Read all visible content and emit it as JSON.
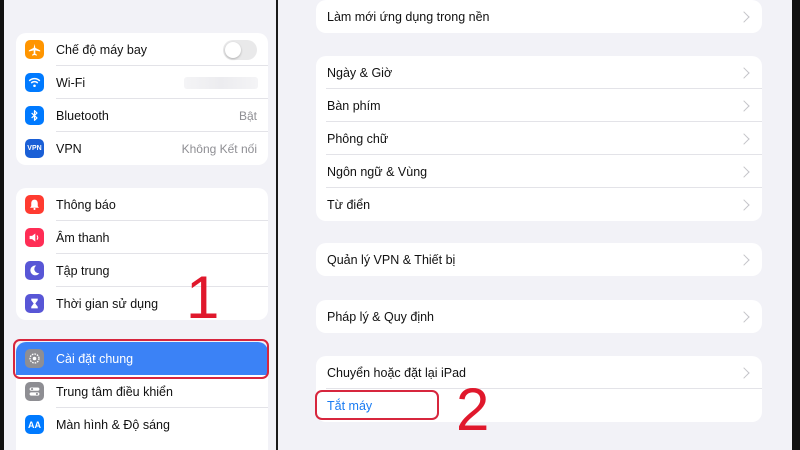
{
  "sidebar": {
    "group1": [
      {
        "label": "Chế độ máy bay",
        "icon": "airplane-icon",
        "color": "#ff9500",
        "control": "toggle-off"
      },
      {
        "label": "Wi-Fi",
        "icon": "wifi-icon",
        "color": "#007aff",
        "control": "blurred"
      },
      {
        "label": "Bluetooth",
        "icon": "bluetooth-icon",
        "color": "#007aff",
        "value": "Bật"
      },
      {
        "label": "VPN",
        "icon": "vpn-icon",
        "icon_text": "VPN",
        "color": "#1a5fd6",
        "value": "Không Kết nối"
      }
    ],
    "group2": [
      {
        "label": "Thông báo",
        "icon": "bell-icon",
        "color": "#ff3b30"
      },
      {
        "label": "Âm thanh",
        "icon": "speaker-icon",
        "color": "#ff2d55"
      },
      {
        "label": "Tập trung",
        "icon": "moon-icon",
        "color": "#5856d6"
      },
      {
        "label": "Thời gian sử dụng",
        "icon": "hourglass-icon",
        "color": "#5856d6"
      }
    ],
    "group3": [
      {
        "label": "Cài đặt chung",
        "icon": "gear-icon",
        "color": "#8e8e93",
        "selected": true
      },
      {
        "label": "Trung tâm điều khiển",
        "icon": "switches-icon",
        "color": "#8e8e93"
      },
      {
        "label": "Màn hình & Độ sáng",
        "icon": "display-icon",
        "icon_text": "AA",
        "color": "#007aff"
      }
    ]
  },
  "main": {
    "group0": [
      {
        "label": "Làm mới ứng dụng trong nền"
      }
    ],
    "group1": [
      {
        "label": "Ngày & Giờ"
      },
      {
        "label": "Bàn phím"
      },
      {
        "label": "Phông chữ"
      },
      {
        "label": "Ngôn ngữ & Vùng"
      },
      {
        "label": "Từ điển"
      }
    ],
    "group2": [
      {
        "label": "Quản lý VPN & Thiết bị"
      }
    ],
    "group3": [
      {
        "label": "Pháp lý & Quy định"
      }
    ],
    "group4": [
      {
        "label": "Chuyển hoặc đặt lại iPad"
      },
      {
        "label": "Tắt máy",
        "link": true
      }
    ]
  },
  "annotations": {
    "step1": "1",
    "step2": "2",
    "highlight_color": "#d7263d"
  }
}
